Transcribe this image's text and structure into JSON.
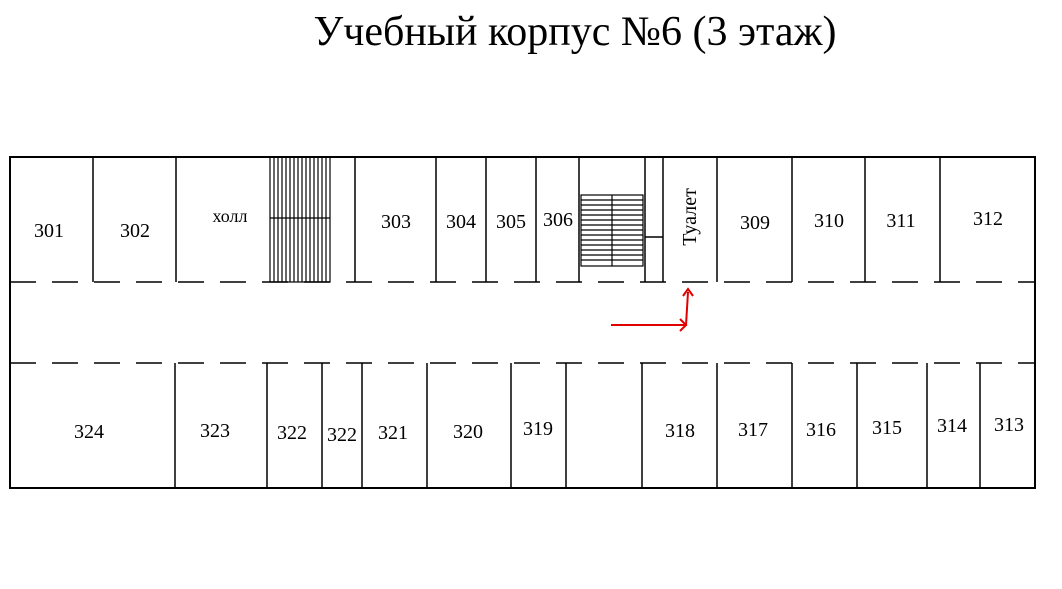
{
  "title": "Учебный корпус №6 (3 этаж)",
  "rooms_top": [
    {
      "id": "r301",
      "label": "301"
    },
    {
      "id": "r302",
      "label": "302"
    },
    {
      "id": "hall",
      "label": "холл"
    },
    {
      "id": "r303",
      "label": "303"
    },
    {
      "id": "r304",
      "label": "304"
    },
    {
      "id": "r305",
      "label": "305"
    },
    {
      "id": "r306",
      "label": "306"
    },
    {
      "id": "toilet",
      "label": "Туалет"
    },
    {
      "id": "r309",
      "label": "309"
    },
    {
      "id": "r310",
      "label": "310"
    },
    {
      "id": "r311",
      "label": "311"
    },
    {
      "id": "r312",
      "label": "312"
    }
  ],
  "rooms_bottom": [
    {
      "id": "r324",
      "label": "324"
    },
    {
      "id": "r323",
      "label": "323"
    },
    {
      "id": "r322a",
      "label": "322"
    },
    {
      "id": "r322b",
      "label": "322"
    },
    {
      "id": "r321",
      "label": "321"
    },
    {
      "id": "r320",
      "label": "320"
    },
    {
      "id": "r319",
      "label": "319"
    },
    {
      "id": "r318",
      "label": "318"
    },
    {
      "id": "r317",
      "label": "317"
    },
    {
      "id": "r316",
      "label": "316"
    },
    {
      "id": "r315",
      "label": "315"
    },
    {
      "id": "r314",
      "label": "314"
    },
    {
      "id": "r313",
      "label": "313"
    }
  ],
  "colors": {
    "walls": "#000000",
    "route_arrow": "#e00000"
  }
}
